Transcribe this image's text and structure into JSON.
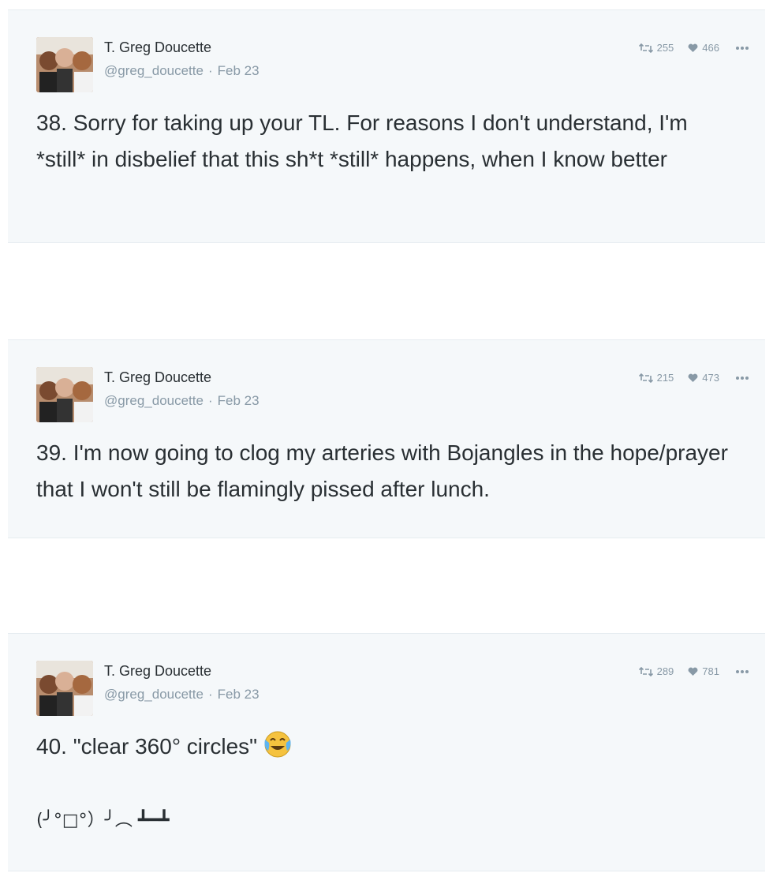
{
  "tweets": [
    {
      "author_name": "T. Greg Doucette",
      "handle": "@greg_doucette",
      "date": "Feb 23",
      "retweets": "255",
      "likes": "466",
      "text": "38. Sorry for taking up your TL. For reasons I don't understand, I'm *still* in disbelief that this sh*t *still* happens, when I know better"
    },
    {
      "author_name": "T. Greg Doucette",
      "handle": "@greg_doucette",
      "date": "Feb 23",
      "retweets": "215",
      "likes": "473",
      "text": "39. I'm now going to clog my arteries with Bojangles in the hope/prayer that I won't still be flamingly pissed after lunch."
    },
    {
      "author_name": "T. Greg Doucette",
      "handle": "@greg_doucette",
      "date": "Feb 23",
      "retweets": "289",
      "likes": "781",
      "text": "40. \"clear 360° circles\"",
      "kaomoji": "(╯°□°）╯︵ ┻━┻"
    }
  ],
  "separator": "·",
  "icons": {
    "retweet": "retweet-icon",
    "like": "heart-icon",
    "more": "more-dots-icon",
    "emoji": "face-with-tears-of-joy-icon"
  },
  "colors": {
    "card_bg": "#f5f8fa",
    "text": "#292f33",
    "muted": "#8899a6"
  }
}
